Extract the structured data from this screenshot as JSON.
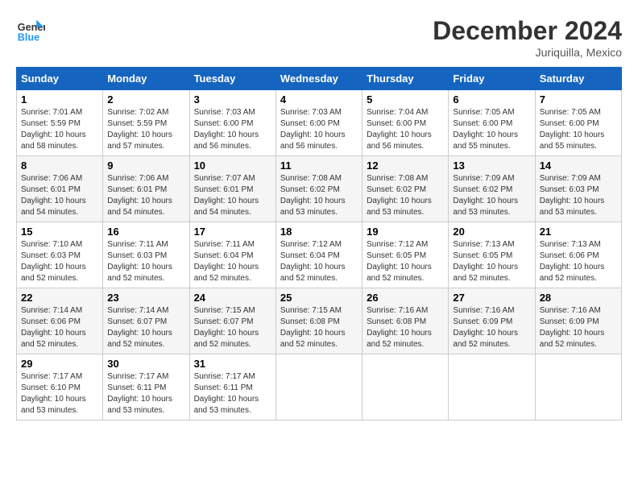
{
  "header": {
    "logo_line1": "General",
    "logo_line2": "Blue",
    "month_year": "December 2024",
    "location": "Juriquilla, Mexico"
  },
  "weekdays": [
    "Sunday",
    "Monday",
    "Tuesday",
    "Wednesday",
    "Thursday",
    "Friday",
    "Saturday"
  ],
  "weeks": [
    [
      {
        "day": "1",
        "sunrise": "7:01 AM",
        "sunset": "5:59 PM",
        "daylight": "10 hours and 58 minutes."
      },
      {
        "day": "2",
        "sunrise": "7:02 AM",
        "sunset": "5:59 PM",
        "daylight": "10 hours and 57 minutes."
      },
      {
        "day": "3",
        "sunrise": "7:03 AM",
        "sunset": "6:00 PM",
        "daylight": "10 hours and 56 minutes."
      },
      {
        "day": "4",
        "sunrise": "7:03 AM",
        "sunset": "6:00 PM",
        "daylight": "10 hours and 56 minutes."
      },
      {
        "day": "5",
        "sunrise": "7:04 AM",
        "sunset": "6:00 PM",
        "daylight": "10 hours and 56 minutes."
      },
      {
        "day": "6",
        "sunrise": "7:05 AM",
        "sunset": "6:00 PM",
        "daylight": "10 hours and 55 minutes."
      },
      {
        "day": "7",
        "sunrise": "7:05 AM",
        "sunset": "6:00 PM",
        "daylight": "10 hours and 55 minutes."
      }
    ],
    [
      {
        "day": "8",
        "sunrise": "7:06 AM",
        "sunset": "6:01 PM",
        "daylight": "10 hours and 54 minutes."
      },
      {
        "day": "9",
        "sunrise": "7:06 AM",
        "sunset": "6:01 PM",
        "daylight": "10 hours and 54 minutes."
      },
      {
        "day": "10",
        "sunrise": "7:07 AM",
        "sunset": "6:01 PM",
        "daylight": "10 hours and 54 minutes."
      },
      {
        "day": "11",
        "sunrise": "7:08 AM",
        "sunset": "6:02 PM",
        "daylight": "10 hours and 53 minutes."
      },
      {
        "day": "12",
        "sunrise": "7:08 AM",
        "sunset": "6:02 PM",
        "daylight": "10 hours and 53 minutes."
      },
      {
        "day": "13",
        "sunrise": "7:09 AM",
        "sunset": "6:02 PM",
        "daylight": "10 hours and 53 minutes."
      },
      {
        "day": "14",
        "sunrise": "7:09 AM",
        "sunset": "6:03 PM",
        "daylight": "10 hours and 53 minutes."
      }
    ],
    [
      {
        "day": "15",
        "sunrise": "7:10 AM",
        "sunset": "6:03 PM",
        "daylight": "10 hours and 52 minutes."
      },
      {
        "day": "16",
        "sunrise": "7:11 AM",
        "sunset": "6:03 PM",
        "daylight": "10 hours and 52 minutes."
      },
      {
        "day": "17",
        "sunrise": "7:11 AM",
        "sunset": "6:04 PM",
        "daylight": "10 hours and 52 minutes."
      },
      {
        "day": "18",
        "sunrise": "7:12 AM",
        "sunset": "6:04 PM",
        "daylight": "10 hours and 52 minutes."
      },
      {
        "day": "19",
        "sunrise": "7:12 AM",
        "sunset": "6:05 PM",
        "daylight": "10 hours and 52 minutes."
      },
      {
        "day": "20",
        "sunrise": "7:13 AM",
        "sunset": "6:05 PM",
        "daylight": "10 hours and 52 minutes."
      },
      {
        "day": "21",
        "sunrise": "7:13 AM",
        "sunset": "6:06 PM",
        "daylight": "10 hours and 52 minutes."
      }
    ],
    [
      {
        "day": "22",
        "sunrise": "7:14 AM",
        "sunset": "6:06 PM",
        "daylight": "10 hours and 52 minutes."
      },
      {
        "day": "23",
        "sunrise": "7:14 AM",
        "sunset": "6:07 PM",
        "daylight": "10 hours and 52 minutes."
      },
      {
        "day": "24",
        "sunrise": "7:15 AM",
        "sunset": "6:07 PM",
        "daylight": "10 hours and 52 minutes."
      },
      {
        "day": "25",
        "sunrise": "7:15 AM",
        "sunset": "6:08 PM",
        "daylight": "10 hours and 52 minutes."
      },
      {
        "day": "26",
        "sunrise": "7:16 AM",
        "sunset": "6:08 PM",
        "daylight": "10 hours and 52 minutes."
      },
      {
        "day": "27",
        "sunrise": "7:16 AM",
        "sunset": "6:09 PM",
        "daylight": "10 hours and 52 minutes."
      },
      {
        "day": "28",
        "sunrise": "7:16 AM",
        "sunset": "6:09 PM",
        "daylight": "10 hours and 52 minutes."
      }
    ],
    [
      {
        "day": "29",
        "sunrise": "7:17 AM",
        "sunset": "6:10 PM",
        "daylight": "10 hours and 53 minutes."
      },
      {
        "day": "30",
        "sunrise": "7:17 AM",
        "sunset": "6:11 PM",
        "daylight": "10 hours and 53 minutes."
      },
      {
        "day": "31",
        "sunrise": "7:17 AM",
        "sunset": "6:11 PM",
        "daylight": "10 hours and 53 minutes."
      },
      null,
      null,
      null,
      null
    ]
  ]
}
